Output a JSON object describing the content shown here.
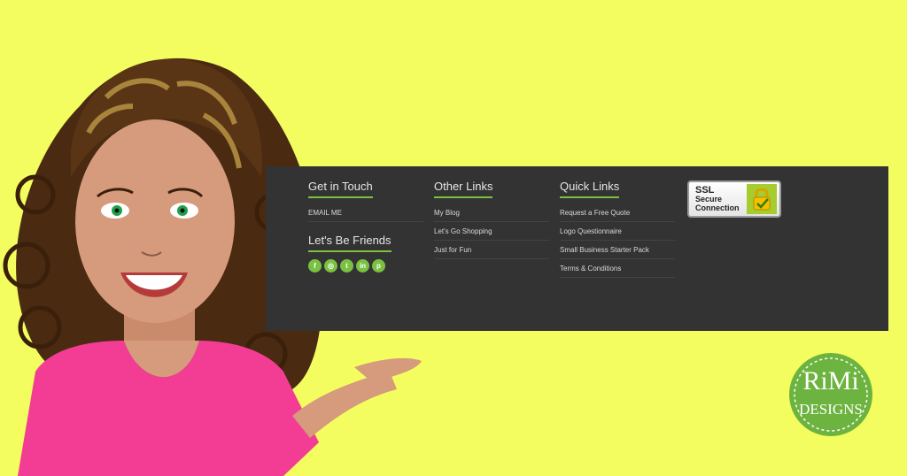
{
  "footer": {
    "get_in_touch": {
      "title": "Get in Touch",
      "links": [
        "EMAIL ME"
      ]
    },
    "friends": {
      "title": "Let's Be Friends",
      "icons": [
        "facebook-icon",
        "instagram-icon",
        "twitter-icon",
        "linkedin-icon",
        "pinterest-icon"
      ],
      "glyphs": [
        "f",
        "◎",
        "t",
        "in",
        "p"
      ]
    },
    "other_links": {
      "title": "Other Links",
      "links": [
        "My Blog",
        "Let's Go Shopping",
        "Just for Fun"
      ]
    },
    "quick_links": {
      "title": "Quick Links",
      "links": [
        "Request a Free Quote",
        "Logo Questionnaire",
        "Small Business Starter Pack",
        "Terms & Conditions"
      ]
    },
    "ssl": {
      "line1": "SSL",
      "line2": "Secure",
      "line3": "Connection"
    }
  },
  "brand": {
    "logo_top": "RiMi",
    "logo_bottom": "DESIGNS"
  },
  "colors": {
    "background": "#f3fd60",
    "panel": "#333333",
    "accent": "#7ac142",
    "shirt": "#f33c94",
    "skin": "#d69a7c",
    "hair": "#5a3515"
  }
}
